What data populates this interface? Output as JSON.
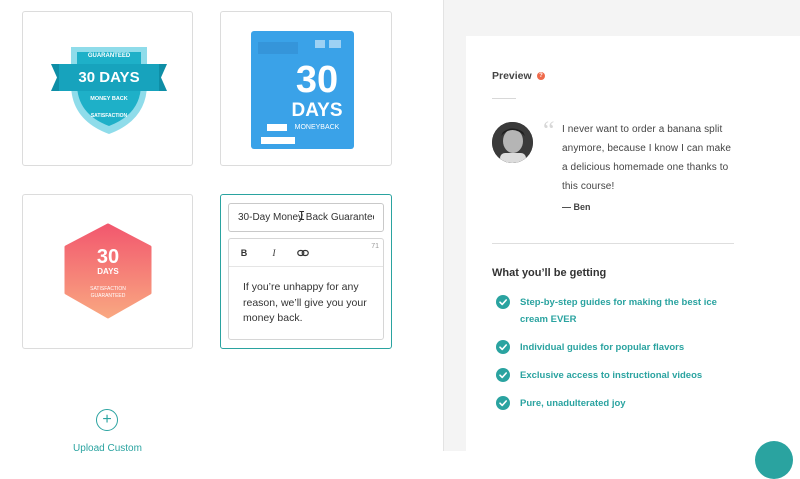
{
  "badges": [
    {
      "top_label": "GUARANTEED",
      "main": "30 DAYS",
      "sub": "MONEY BACK",
      "bottom_label": "SATISFACTION"
    },
    {
      "number": "30",
      "word": "DAYS",
      "sub": "MONEYBACK"
    },
    {
      "number": "30",
      "word": "DAYS",
      "line1": "SATISFACTION",
      "line2": "GUARANTEED"
    }
  ],
  "editor": {
    "title_value": "30-Day Money Back Guarantee",
    "bold_label": "B",
    "italic_label": "I",
    "char_count": "71",
    "body": "If you’re unhappy for any reason, we’ll give you your money back."
  },
  "upload": {
    "label": "Upload Custom"
  },
  "preview": {
    "title": "Preview",
    "help": "?",
    "quote": "I never want to order a banana split anymore, because I know I can make a delicious homemade one thanks to this course!",
    "author": "— Ben",
    "getting_title": "What you’ll be getting",
    "benefits": [
      "Step-by-step guides for making the best ice cream EVER",
      "Individual guides for popular flavors",
      "Exclusive access to instructional videos",
      "Pure, unadulterated joy"
    ]
  },
  "colors": {
    "accent": "#2aa3a0",
    "badge_teal": "#17a3bd",
    "badge_blue": "#3aa2e8",
    "badge_pink": "#f46a70"
  }
}
